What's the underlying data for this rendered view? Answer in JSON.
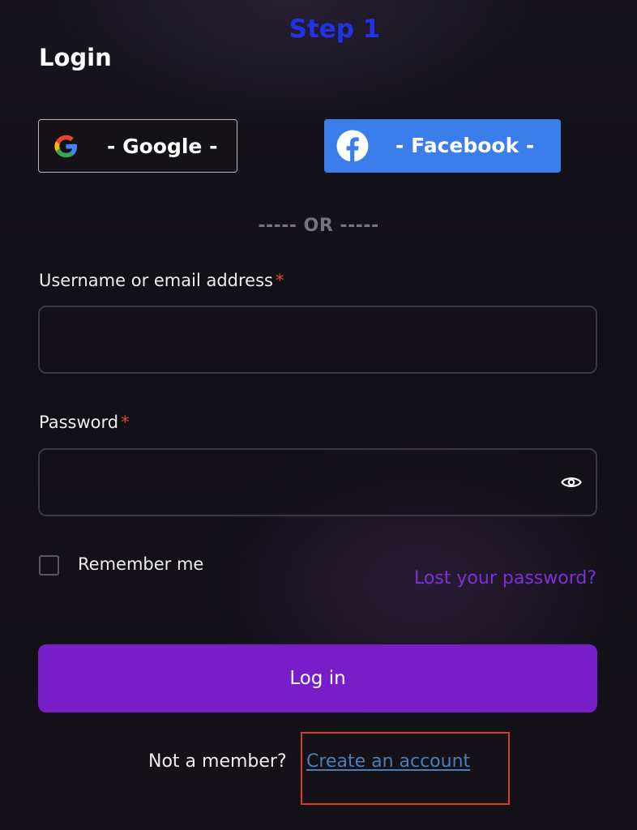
{
  "annotation": {
    "step_label": "Step 1",
    "highlight_color": "#d43d26"
  },
  "login": {
    "title": "Login",
    "google_button": {
      "label": "- Google -",
      "icon": "google-icon"
    },
    "facebook_button": {
      "label": "- Facebook -",
      "icon": "facebook-icon",
      "color": "#3b7eea"
    },
    "divider": "----- OR -----",
    "username": {
      "label": "Username or email address",
      "required_mark": "*",
      "value": ""
    },
    "password": {
      "label": "Password",
      "required_mark": "*",
      "value": "",
      "toggle_icon": "eye-icon"
    },
    "remember_me": {
      "label": "Remember me",
      "checked": false
    },
    "lost_password_link": "Lost your password?",
    "submit_label": "Log in",
    "submit_color": "#781ec8",
    "footer": {
      "prompt": "Not a member?",
      "create_account_link": "Create an account"
    }
  }
}
